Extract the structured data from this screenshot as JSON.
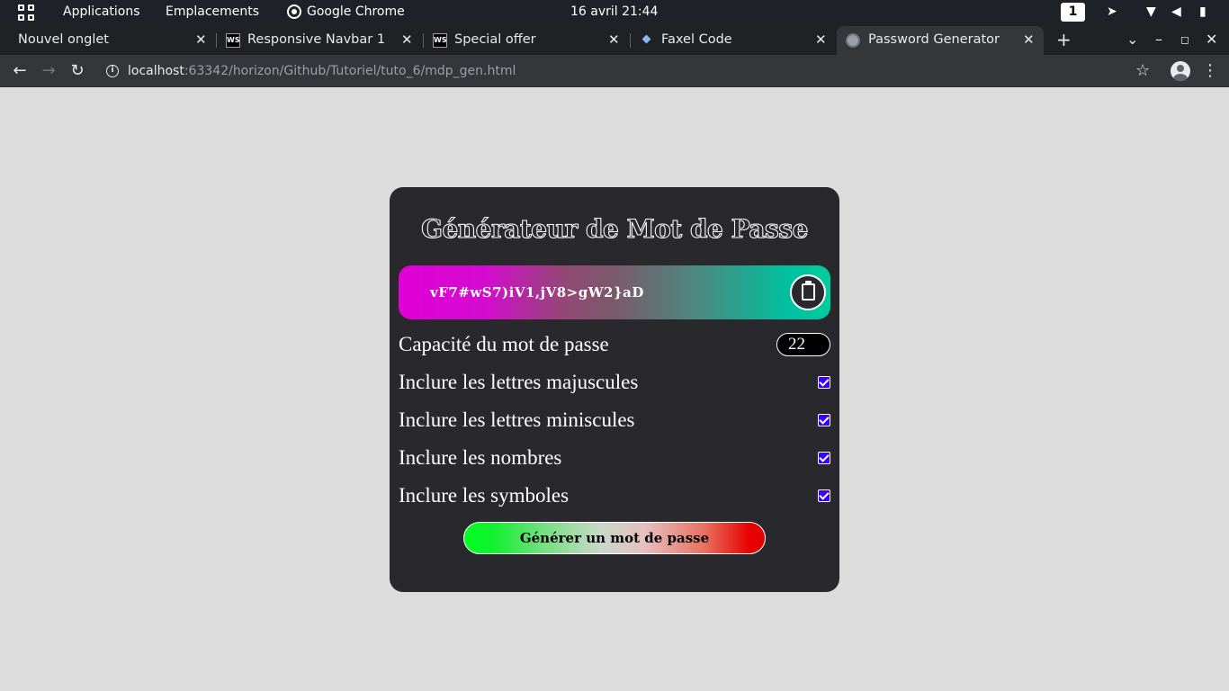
{
  "topbar": {
    "applications": "Applications",
    "places": "Emplacements",
    "active_app": "Google Chrome",
    "clock": "16 avril  21:44",
    "workspace": "1"
  },
  "tabs": [
    {
      "title": "Nouvel onglet",
      "favicon": "none"
    },
    {
      "title": "Responsive Navbar 1",
      "favicon": "webstorm-icon"
    },
    {
      "title": "Special offer",
      "favicon": "webstorm-icon"
    },
    {
      "title": "Faxel Code",
      "favicon": "diamond-icon"
    },
    {
      "title": "Password Generator",
      "favicon": "globe-icon",
      "active": true
    }
  ],
  "tab_close": "✕",
  "new_tab": "+",
  "address": {
    "host": "localhost",
    "path": ":63342/horizon/Github/Tutoriel/tuto_6/mdp_gen.html"
  },
  "app": {
    "title": "Générateur de Mot de Passe",
    "password": "vF7#wS7)iV1,jV8>gW2}aD",
    "length_label": "Capacité du mot de passe",
    "length_value": "22",
    "options": [
      {
        "label": "Inclure les lettres majuscules",
        "checked": true
      },
      {
        "label": "Inclure les lettres miniscules",
        "checked": true
      },
      {
        "label": "Inclure les nombres",
        "checked": true
      },
      {
        "label": "Inclure les symboles",
        "checked": true
      }
    ],
    "generate_label": "Générer un mot de passe"
  },
  "colors": {
    "page_bg": "#dcdcdc",
    "card_bg": "#29282d",
    "checkbox": "#3700ff"
  }
}
